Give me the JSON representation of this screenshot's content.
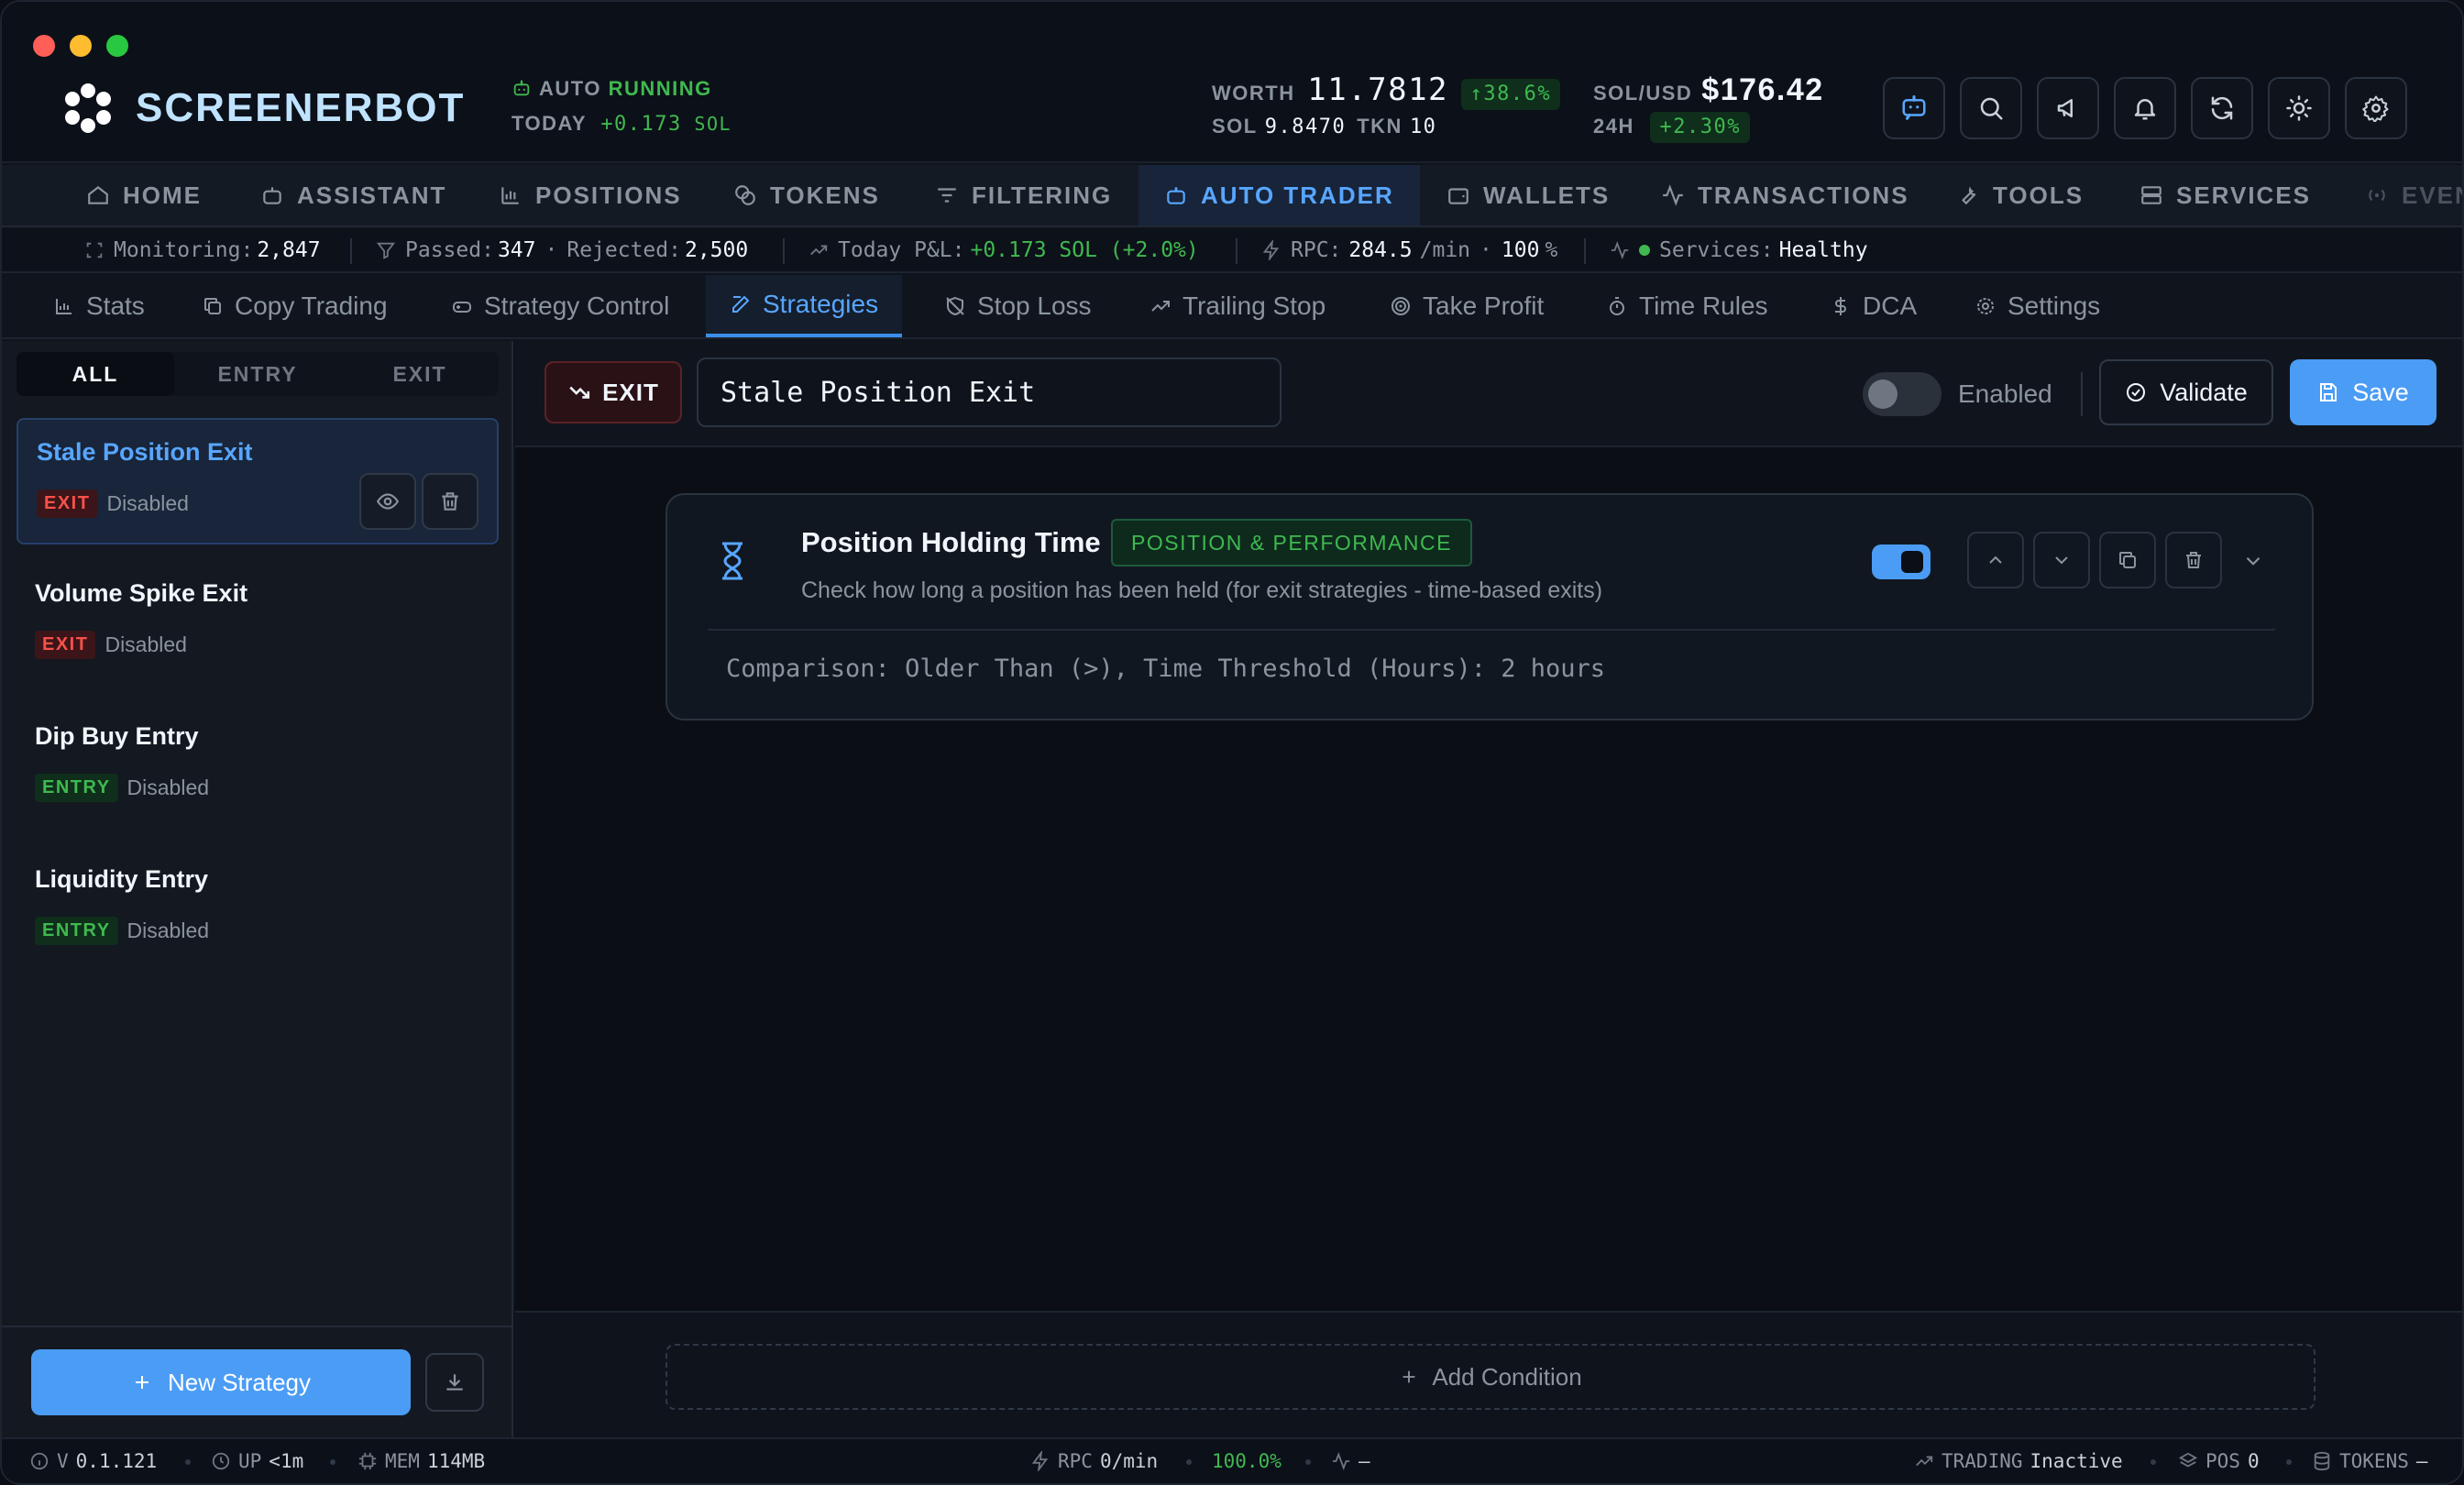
{
  "window": {
    "traffic_lights": [
      "#ff5f57",
      "#febc2e",
      "#28c840"
    ]
  },
  "brand": {
    "name": "SCREENERBOT"
  },
  "header": {
    "auto_label": "AUTO",
    "auto_status": "RUNNING",
    "today_label": "TODAY",
    "today_value": "+0.173",
    "today_unit": "SOL",
    "worth_label": "WORTH",
    "worth_value": "11.7812",
    "worth_change": "↑38.6%",
    "sol_label": "SOL",
    "sol_value": "9.8470",
    "tkn_label": "TKN",
    "tkn_value": "10",
    "solusd_label": "SOL/USD",
    "solusd_value": "$176.42",
    "h24_label": "24H",
    "h24_value": "+2.30%",
    "icons": [
      "assistant-icon",
      "search-icon",
      "megaphone-icon",
      "bell-icon",
      "refresh-icon",
      "sun-icon",
      "gear-icon"
    ]
  },
  "nav": {
    "items": [
      {
        "label": "HOME",
        "icon": "home-icon"
      },
      {
        "label": "ASSISTANT",
        "icon": "bot-icon"
      },
      {
        "label": "POSITIONS",
        "icon": "chart-icon"
      },
      {
        "label": "TOKENS",
        "icon": "coins-icon"
      },
      {
        "label": "FILTERING",
        "icon": "filter-icon"
      },
      {
        "label": "AUTO TRADER",
        "icon": "bot-icon",
        "active": true
      },
      {
        "label": "WALLETS",
        "icon": "wallet-icon"
      },
      {
        "label": "TRANSACTIONS",
        "icon": "activity-icon"
      },
      {
        "label": "TOOLS",
        "icon": "wrench-icon"
      },
      {
        "label": "SERVICES",
        "icon": "server-icon"
      },
      {
        "label": "EVEN",
        "icon": "radio-icon"
      }
    ]
  },
  "statusbar": {
    "monitoring_label": "Monitoring:",
    "monitoring_value": "2,847",
    "passed_label": "Passed:",
    "passed_value": "347",
    "rejected_label": "Rejected:",
    "rejected_value": "2,500",
    "pnl_label": "Today P&L:",
    "pnl_value": "+0.173 SOL (+2.0%)",
    "rpc_label": "RPC:",
    "rpc_value": "284.5",
    "rpc_unit": "/min",
    "rpc_pct": "100",
    "rpc_pct_unit": "%",
    "services_label": "Services:",
    "services_value": "Healthy"
  },
  "subtabs": {
    "items": [
      {
        "label": "Stats",
        "icon": "bar-chart-icon"
      },
      {
        "label": "Copy Trading",
        "icon": "copy-icon"
      },
      {
        "label": "Strategy Control",
        "icon": "joystick-icon"
      },
      {
        "label": "Strategies",
        "icon": "edit-icon",
        "active": true
      },
      {
        "label": "Stop Loss",
        "icon": "shield-off-icon"
      },
      {
        "label": "Trailing Stop",
        "icon": "trending-up-icon"
      },
      {
        "label": "Take Profit",
        "icon": "target-icon"
      },
      {
        "label": "Time Rules",
        "icon": "timer-icon"
      },
      {
        "label": "DCA",
        "icon": "dollar-icon"
      },
      {
        "label": "Settings",
        "icon": "gear-icon"
      }
    ]
  },
  "sidebar": {
    "filters": [
      "ALL",
      "ENTRY",
      "EXIT"
    ],
    "strategies": [
      {
        "name": "Stale Position Exit",
        "type": "EXIT",
        "status": "Disabled",
        "selected": true
      },
      {
        "name": "Volume Spike Exit",
        "type": "EXIT",
        "status": "Disabled"
      },
      {
        "name": "Dip Buy Entry",
        "type": "ENTRY",
        "status": "Disabled"
      },
      {
        "name": "Liquidity Entry",
        "type": "ENTRY",
        "status": "Disabled"
      }
    ],
    "new_button": "New Strategy"
  },
  "editor": {
    "type_badge": "EXIT",
    "name_value": "Stale Position Exit",
    "enabled_label": "Enabled",
    "enabled": false,
    "validate_label": "Validate",
    "save_label": "Save",
    "condition": {
      "title": "Position Holding Time",
      "category": "POSITION & PERFORMANCE",
      "description": "Check how long a position has been held (for exit strategies - time-based exits)",
      "enabled": true,
      "summary": "Comparison: Older Than (>), Time Threshold (Hours): 2 hours"
    },
    "add_condition": "Add Condition"
  },
  "footer": {
    "version_label": "V",
    "version": "0.1.121",
    "up_label": "UP",
    "up_value": "<1m",
    "mem_label": "MEM",
    "mem_value": "114MB",
    "rpc_label": "RPC",
    "rpc_value": "0/min",
    "rpc_pct": "100.0%",
    "pulse_value": "–",
    "trading_label": "TRADING",
    "trading_value": "Inactive",
    "pos_label": "POS",
    "pos_value": "0",
    "tokens_label": "TOKENS",
    "tokens_value": "–"
  },
  "colors": {
    "accent": "#4b9cf5",
    "positive": "#3fb950",
    "negative": "#f85149",
    "background": "#0b0e14"
  }
}
